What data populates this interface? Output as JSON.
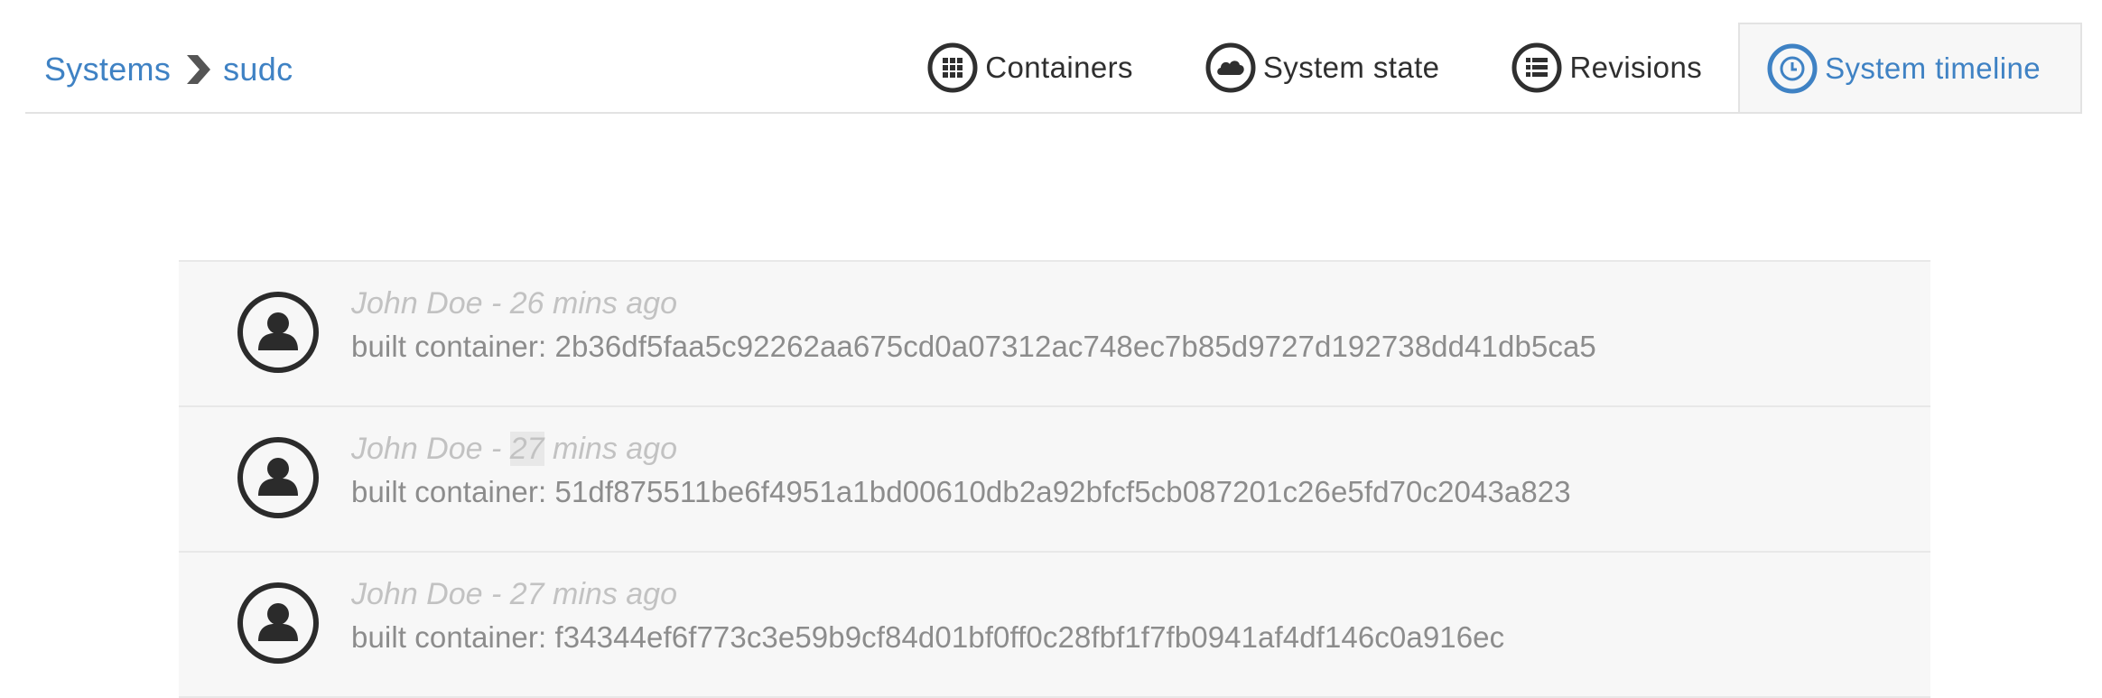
{
  "breadcrumb": {
    "root": "Systems",
    "current": "sudc"
  },
  "tabs": [
    {
      "label": "Containers",
      "icon": "grid-icon",
      "active": false
    },
    {
      "label": "System state",
      "icon": "cloud-icon",
      "active": false
    },
    {
      "label": "Revisions",
      "icon": "list-icon",
      "active": false
    },
    {
      "label": "System timeline",
      "icon": "clock-icon",
      "active": true
    }
  ],
  "timeline": [
    {
      "user": "John Doe",
      "sep": " - ",
      "time_value": "26",
      "time_unit": " mins ago",
      "text": "built container: 2b36df5faa5c92262aa675cd0a07312ac748ec7b85d9727d192738dd41db5ca5",
      "avatar": "user-avatar-icon"
    },
    {
      "user": "John Doe",
      "sep": " - ",
      "time_value": "27",
      "time_unit": " mins ago",
      "text": "built container: 51df875511be6f4951a1bd00610db2a92bfcf5cb087201c26e5fd70c2043a823",
      "avatar": "user-avatar-icon"
    },
    {
      "user": "John Doe",
      "sep": " - ",
      "time_value": "27",
      "time_unit": " mins ago",
      "text": "built container: f34344ef6f773c3e59b9cf84d01bf0ff0c28fbf1f7fb0941af4df146c0a916ec",
      "avatar": "user-avatar-icon"
    }
  ],
  "colors": {
    "accent": "#3f82c4",
    "text_dark": "#2f2f2f",
    "entry_bg": "#f7f7f7",
    "meta_text": "#c2c2c2",
    "body_text": "#8c8c8c"
  }
}
